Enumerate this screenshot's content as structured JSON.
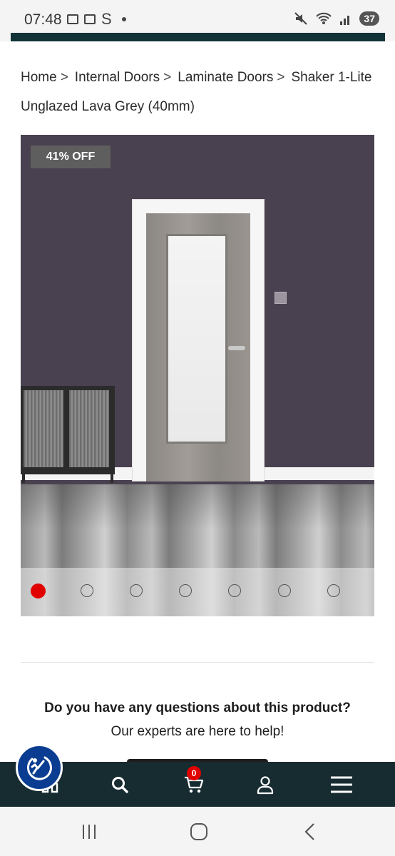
{
  "status_bar": {
    "time": "07:48",
    "left_icons": [
      "screenshot-icon",
      "calendar-icon",
      "s-app-icon",
      "dot-icon"
    ],
    "s_glyph": "S",
    "right_icons": [
      "mute-icon",
      "wifi-icon",
      "signal-icon"
    ],
    "battery": "37"
  },
  "breadcrumb": {
    "items": [
      "Home",
      "Internal Doors",
      "Laminate Doors",
      "Shaker 1-Lite Unglazed Lava Grey (40mm)"
    ],
    "separator": ">"
  },
  "gallery": {
    "badge": "41% OFF",
    "slide_count": 7,
    "active_slide": 1,
    "active_color": "#e10000"
  },
  "help": {
    "question": "Do you have any questions about this product?",
    "subtitle": "Our experts are here to help!"
  },
  "bottom_nav": {
    "background": "#172c31",
    "items": [
      "home-icon",
      "search-icon",
      "cart-icon",
      "account-icon",
      "menu-icon"
    ],
    "cart_count": "0"
  },
  "accessibility": {
    "icon": "accessibility-icon",
    "color": "#0a3d91"
  },
  "android_nav": {
    "items": [
      "recents-icon",
      "home-button-icon",
      "back-icon"
    ]
  }
}
